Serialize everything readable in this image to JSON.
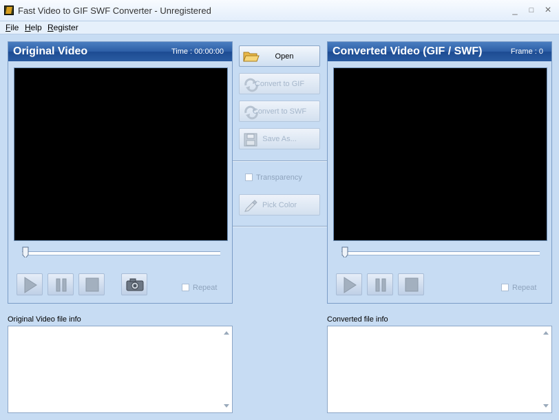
{
  "window": {
    "title": "Fast Video to GIF SWF Converter - Unregistered",
    "minimize_glyph": "_",
    "maximize_glyph": "□",
    "close_glyph": "×"
  },
  "menu": [
    {
      "label": "File",
      "accel": "F",
      "rest": "ile"
    },
    {
      "label": "Help",
      "accel": "H",
      "rest": "elp"
    },
    {
      "label": "Register",
      "accel": "R",
      "rest": "egister"
    }
  ],
  "original_panel": {
    "title": "Original Video",
    "meta": "Time : 00:00:00",
    "repeat_label": "Repeat"
  },
  "converted_panel": {
    "title": "Converted Video (GIF / SWF)",
    "meta": "Frame : 0",
    "repeat_label": "Repeat"
  },
  "actions": {
    "open": "Open",
    "convert_gif": "Convert to GIF",
    "convert_swf": "Convert to SWF",
    "save_as": "Save As...",
    "transparency": "Transparency",
    "pick_color": "Pick Color"
  },
  "info": {
    "original_label": "Original Video file info",
    "converted_label": "Converted file info"
  },
  "icons": {
    "open": "folder-icon",
    "convert": "refresh-arrows-icon",
    "save": "floppy-disk-icon",
    "pick": "eyedropper-icon",
    "play": "play-icon",
    "pause": "pause-icon",
    "stop": "stop-icon",
    "snapshot": "camera-icon"
  },
  "colors": {
    "header_blue": "#2d5ea6",
    "window_bg": "#c7dcf3",
    "disabled_text": "#a5b6ca"
  }
}
